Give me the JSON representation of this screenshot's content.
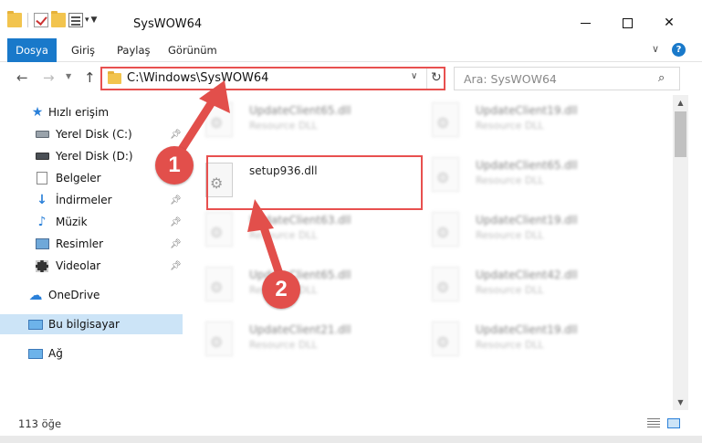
{
  "window": {
    "title": "SysWOW64"
  },
  "ribbon": {
    "tabs": [
      "Dosya",
      "Giriş",
      "Paylaş",
      "Görünüm"
    ]
  },
  "address_bar": {
    "path": "C:\\Windows\\SysWOW64"
  },
  "search": {
    "placeholder": "Ara: SysWOW64"
  },
  "sidebar": {
    "items": [
      {
        "label": "Hızlı erişim",
        "icon": "star-icon",
        "pinned": false
      },
      {
        "label": "Yerel Disk (C:)",
        "icon": "disk-icon",
        "pinned": true
      },
      {
        "label": "Yerel Disk (D:)",
        "icon": "disk-icon",
        "pinned": false
      },
      {
        "label": "Belgeler",
        "icon": "documents-icon",
        "pinned": true
      },
      {
        "label": "İndirmeler",
        "icon": "download-icon",
        "pinned": true
      },
      {
        "label": "Müzik",
        "icon": "music-icon",
        "pinned": true
      },
      {
        "label": "Resimler",
        "icon": "pictures-icon",
        "pinned": true
      },
      {
        "label": "Videolar",
        "icon": "video-icon",
        "pinned": true
      },
      {
        "label": "OneDrive",
        "icon": "cloud-icon",
        "pinned": false
      },
      {
        "label": "Bu bilgisayar",
        "icon": "computer-icon",
        "pinned": false,
        "selected": true
      },
      {
        "label": "Ağ",
        "icon": "network-icon",
        "pinned": false
      }
    ]
  },
  "files": [
    {
      "name": "UpdateClient65.dll",
      "type": "Resource DLL",
      "blurred": true
    },
    {
      "name": "UpdateClient19.dll",
      "type": "Resource DLL",
      "blurred": true
    },
    {
      "name": "setup936.dll",
      "type": "",
      "blurred": false
    },
    {
      "name": "UpdateClient65.dll",
      "type": "Resource DLL",
      "blurred": true
    },
    {
      "name": "UpdateClient63.dll",
      "type": "Resource DLL",
      "blurred": true
    },
    {
      "name": "UpdateClient19.dll",
      "type": "Resource DLL",
      "blurred": true
    },
    {
      "name": "UpdateClient65.dll",
      "type": "Resource DLL",
      "blurred": true
    },
    {
      "name": "UpdateClient42.dll",
      "type": "Resource DLL",
      "blurred": true
    },
    {
      "name": "UpdateClient21.dll",
      "type": "Resource DLL",
      "blurred": true
    },
    {
      "name": "UpdateClient19.dll",
      "type": "Resource DLL",
      "blurred": true
    }
  ],
  "status_bar": {
    "item_count": "113 öğe"
  },
  "annotations": {
    "step1": "1",
    "step2": "2",
    "color": "#e24f4b"
  }
}
